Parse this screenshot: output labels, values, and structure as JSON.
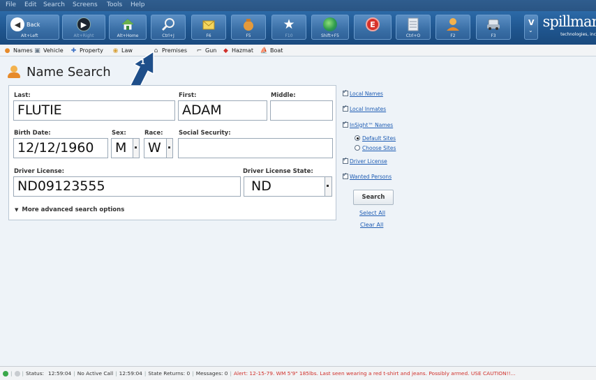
{
  "menu": [
    "File",
    "Edit",
    "Search",
    "Screens",
    "Tools",
    "Help"
  ],
  "toolbar": {
    "back": {
      "label": "Back",
      "shortcut": "Alt+Left"
    },
    "forward": {
      "shortcut": "Alt+Right"
    },
    "home": {
      "shortcut": "Alt+Home"
    },
    "search": {
      "shortcut": "Ctrl+J"
    },
    "mail": {
      "shortcut": "F6"
    },
    "bag": {
      "shortcut": "F5"
    },
    "favorite": {
      "shortcut": "F10"
    },
    "globe": {
      "shortcut": "Shift+F5"
    },
    "emergency": {
      "shortcut": ""
    },
    "doc": {
      "shortcut": "Ctrl+O"
    },
    "person": {
      "shortcut": "F2"
    },
    "vehicle": {
      "shortcut": "F3"
    },
    "more": {
      "label": "V"
    }
  },
  "logo": {
    "brand": "spillman",
    "tagline": "technologies, inc"
  },
  "modules": [
    "Names",
    "Vehicle",
    "Property",
    "Law",
    "Premises",
    "Gun",
    "Hazmat",
    "Boat"
  ],
  "callout": {
    "number": "1"
  },
  "page": {
    "title": "Name Search"
  },
  "form": {
    "last": {
      "label": "Last:",
      "value": "FLUTIE"
    },
    "first": {
      "label": "First:",
      "value": "ADAM"
    },
    "middle": {
      "label": "Middle:",
      "value": ""
    },
    "birth_date": {
      "label": "Birth Date:",
      "value": "12/12/1960"
    },
    "sex": {
      "label": "Sex:",
      "value": "M"
    },
    "race": {
      "label": "Race:",
      "value": "W"
    },
    "ssn": {
      "label": "Social Security:",
      "value": ""
    },
    "driver_license": {
      "label": "Driver License:",
      "value": "ND09123555"
    },
    "dl_state": {
      "label": "Driver License State:",
      "value": "ND"
    },
    "more_options": "More advanced search options"
  },
  "options": {
    "local_names": {
      "label": "Local Names",
      "checked": true
    },
    "local_inmates": {
      "label": "Local Inmates",
      "checked": true
    },
    "insight_names": {
      "label": "InSight™ Names",
      "checked": true
    },
    "default_sites": {
      "label": "Default Sites",
      "selected": true
    },
    "choose_sites": {
      "label": "Choose Sites",
      "selected": false
    },
    "driver_license": {
      "label": "Driver License",
      "checked": true
    },
    "wanted_persons": {
      "label": "Wanted Persons",
      "checked": true
    },
    "search_button": "Search",
    "select_all": "Select All",
    "clear_all": "Clear All"
  },
  "status": {
    "status_label": "Status:",
    "time1": "12:59:04",
    "active_call": "No Active Call",
    "time2": "12:59:04",
    "state_returns": "State Returns: 0",
    "messages": "Messages: 0",
    "alert": "Alert:  12-15-79. WM 5'9\" 185lbs. Last seen wearing a red t-shirt and jeans. Possibly armed. USE CAUTION!!..."
  },
  "colors": {
    "accent": "#2c6aa8",
    "link": "#1e5cb3",
    "alert": "#d0302a",
    "callout": "#1f4f8a"
  }
}
